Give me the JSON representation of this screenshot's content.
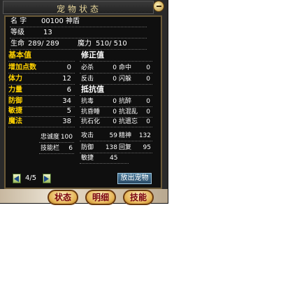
{
  "window": {
    "title": "宠物状态"
  },
  "info": {
    "name_label": "名 字",
    "name_value": "00100 神盾",
    "level_label": "等级",
    "level_value": "13",
    "hp_label": "生命",
    "hp_value": "289/ 289",
    "mp_label": "魔力",
    "mp_value": "510/ 510"
  },
  "base": {
    "header": "基本值",
    "rows": [
      {
        "label": "增加点数",
        "value": "0"
      },
      {
        "label": "体力",
        "value": "12"
      },
      {
        "label": "力量",
        "value": "6"
      },
      {
        "label": "防御",
        "value": "34"
      },
      {
        "label": "敏捷",
        "value": "5"
      },
      {
        "label": "魔法",
        "value": "38"
      }
    ]
  },
  "correction": {
    "header": "修正值",
    "rows": [
      {
        "label1": "必杀",
        "value1": "0",
        "label2": "命中",
        "value2": "0"
      },
      {
        "label1": "反击",
        "value1": "0",
        "label2": "闪躲",
        "value2": "0"
      }
    ]
  },
  "resist": {
    "header": "抵抗值",
    "rows": [
      {
        "label1": "抗毒",
        "value1": "0",
        "label2": "抗醉",
        "value2": "0"
      },
      {
        "label1": "抗昏睡",
        "value1": "0",
        "label2": "抗混乱",
        "value2": "0"
      },
      {
        "label1": "抗石化",
        "value1": "0",
        "label2": "抗遗忘",
        "value2": "0"
      }
    ]
  },
  "extra": {
    "loyalty_label": "忠诚度",
    "loyalty_value": "100",
    "skill_slots_label": "技能栏",
    "skill_slots_value": "6"
  },
  "combat": {
    "attack_label": "攻击",
    "attack_value": "59",
    "spirit_label": "精神",
    "spirit_value": "132",
    "defense_label": "防御",
    "defense_value": "138",
    "recovery_label": "回复",
    "recovery_value": "95",
    "agility_label": "敏捷",
    "agility_value": "45"
  },
  "pager": {
    "label": "4/5"
  },
  "buttons": {
    "release_pet": "放出宠物"
  },
  "tabs": {
    "status": "状态",
    "details": "明细",
    "skills": "技能"
  },
  "colors": {
    "highlight": "#ffd200",
    "title": "#e6d59a",
    "tab_text": "#7a0010"
  }
}
